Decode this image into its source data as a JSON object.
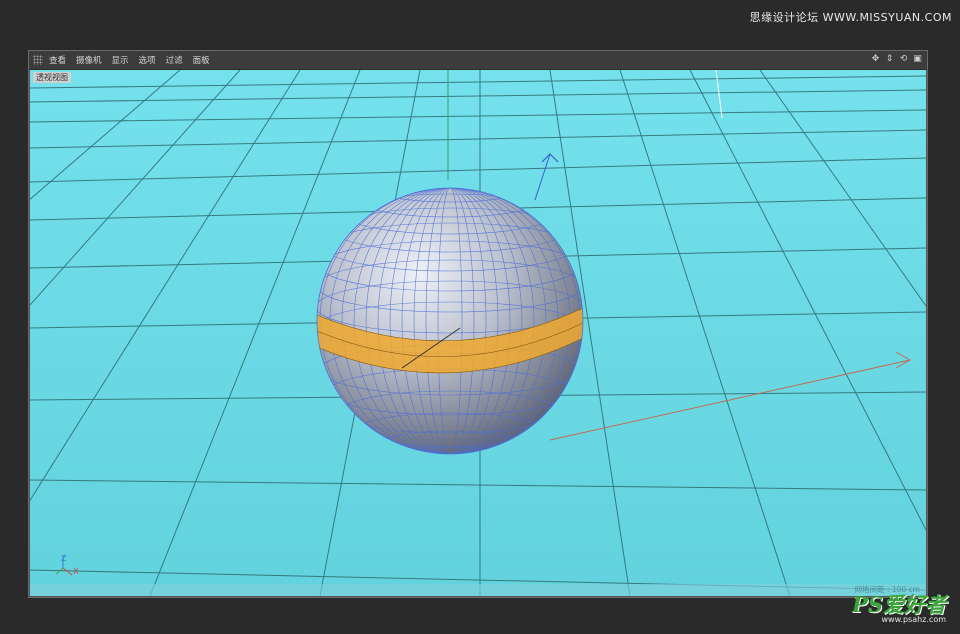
{
  "watermark_top": "思缘设计论坛 WWW.MISSYUAN.COM",
  "menu": {
    "items": [
      "查看",
      "摄像机",
      "显示",
      "选项",
      "过滤",
      "面板"
    ]
  },
  "nav_icons": [
    "move-icon",
    "zoom-icon",
    "rotate-icon",
    "maximize-icon"
  ],
  "viewport": {
    "label": "透视视图",
    "grid_readout": "网格间距 : 100 cm",
    "axis_z": "Z",
    "axis_x": "X",
    "background_color": "#6edbe6",
    "selection_color": "#f0a92e"
  },
  "logo": {
    "brand": "PS爱好者",
    "url": "www.psahz.com"
  }
}
